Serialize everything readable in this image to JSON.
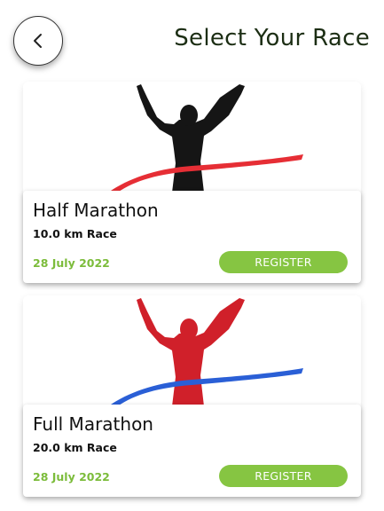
{
  "header": {
    "back_icon": "chevron-left-icon",
    "title": "Select Your Race"
  },
  "races": [
    {
      "name": "Half Marathon",
      "distance": "10.0 km Race",
      "date": "28 July 2022",
      "register_label": "REGISTER",
      "figure_color": "#151515",
      "ribbon_color": "#e62e35",
      "icon": "runner-finish-line-icon"
    },
    {
      "name": "Full Marathon",
      "distance": "20.0 km Race",
      "date": "28 July 2022",
      "register_label": "REGISTER",
      "figure_color": "#d0202a",
      "ribbon_color": "#2a5fd6",
      "icon": "runner-finish-line-icon"
    }
  ],
  "colors": {
    "accent_green": "#86c542",
    "date_green": "#7cbc3b",
    "title_color": "#1c2e14"
  }
}
